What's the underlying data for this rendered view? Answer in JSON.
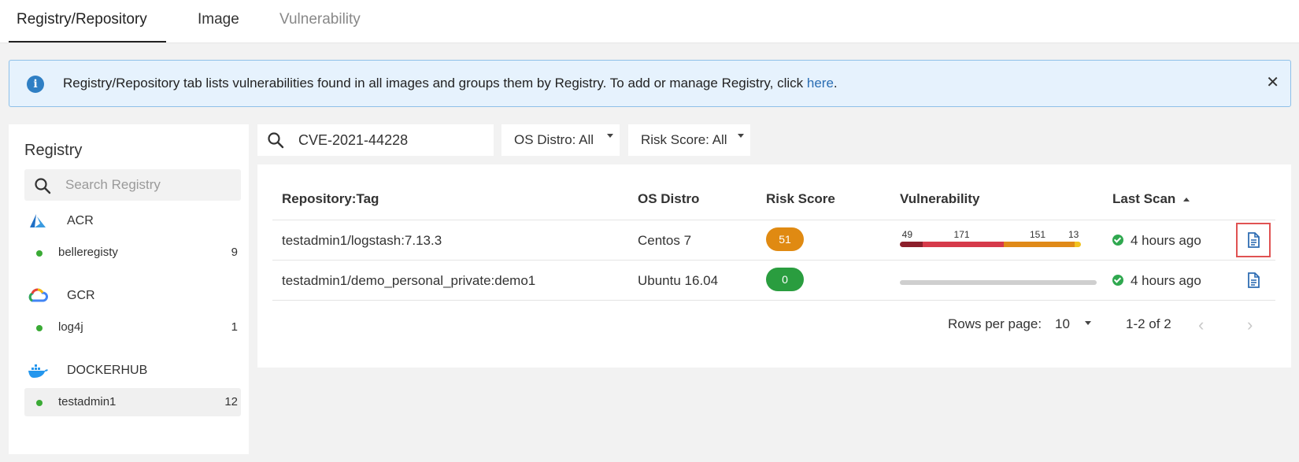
{
  "tabs": [
    {
      "label": "Registry/Repository",
      "active": true
    },
    {
      "label": "Image",
      "active": false
    },
    {
      "label": "Vulnerability",
      "active": false
    }
  ],
  "banner": {
    "text": "Registry/Repository tab lists vulnerabilities found in all images and groups them by Registry. To add or manage Registry, click ",
    "link": "here",
    "suffix": ".",
    "close": "✕"
  },
  "sidebar": {
    "title": "Registry",
    "search_placeholder": "Search Registry",
    "groups": [
      {
        "name": "ACR",
        "icon": "azure-icon",
        "items": [
          {
            "name": "belleregisty",
            "count": "9"
          }
        ]
      },
      {
        "name": "GCR",
        "icon": "google-cloud-icon",
        "items": [
          {
            "name": "log4j",
            "count": "1"
          }
        ]
      },
      {
        "name": "DOCKERHUB",
        "icon": "docker-icon",
        "items": [
          {
            "name": "testadmin1",
            "count": "12",
            "selected": true
          }
        ]
      }
    ]
  },
  "search": {
    "value": "CVE-2021-44228"
  },
  "filters": {
    "os": "OS Distro: All",
    "risk": "Risk Score: All"
  },
  "table": {
    "headers": {
      "repo": "Repository:Tag",
      "os": "OS Distro",
      "risk": "Risk Score",
      "vuln": "Vulnerability",
      "scan": "Last Scan"
    },
    "rows": [
      {
        "repo": "testadmin1/logstash:7.13.3",
        "os": "Centos 7",
        "risk": "51",
        "risk_color": "#e08a12",
        "vuln": [
          {
            "label": "49",
            "value": 49,
            "color": "#8c1f2b"
          },
          {
            "label": "171",
            "value": 171,
            "color": "#d63a4a"
          },
          {
            "label": "151",
            "value": 151,
            "color": "#e08a18"
          },
          {
            "label": "13",
            "value": 13,
            "color": "#f2c21f"
          }
        ],
        "scan": "4 hours ago",
        "report_highlighted": true
      },
      {
        "repo": "testadmin1/demo_personal_private:demo1",
        "os": "Ubuntu 16.04",
        "risk": "0",
        "risk_color": "#2a9d3f",
        "vuln": [],
        "scan": "4 hours ago",
        "report_highlighted": false
      }
    ]
  },
  "pagination": {
    "rows_label": "Rows per page:",
    "rows_value": "10",
    "range": "1-2 of 2",
    "prev": "‹",
    "next": "›"
  },
  "colors": {
    "accent": "#2f7fc4",
    "link": "#2a6db3",
    "banner_bg": "#e6f2fd",
    "status_ok": "#2fa84f"
  }
}
